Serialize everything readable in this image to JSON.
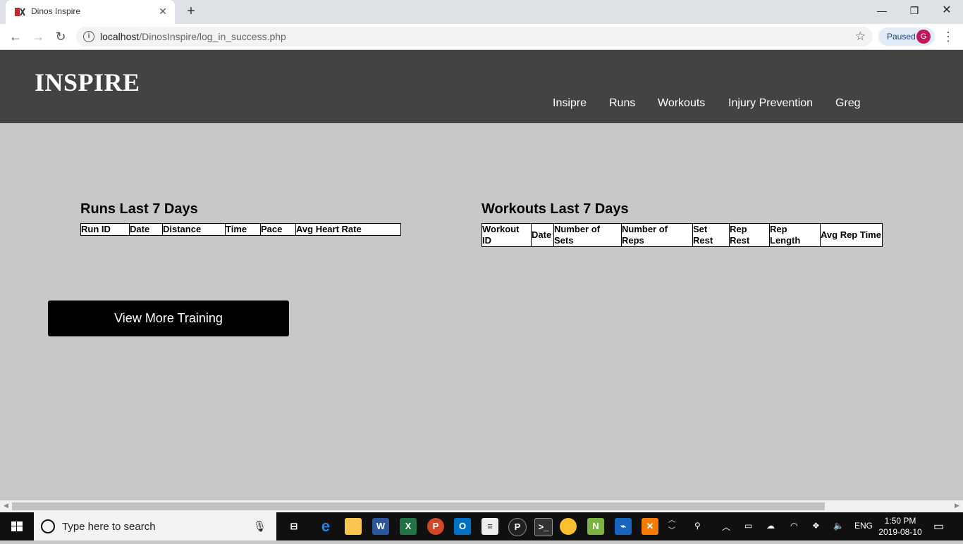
{
  "browser": {
    "tab_title": "Dinos Inspire",
    "url_host": "localhost",
    "url_path": "/DinosInspire/log_in_success.php",
    "profile_status": "Paused",
    "profile_initial": "G"
  },
  "site": {
    "logo": "INSPIRE",
    "nav": [
      "Insipre",
      "Runs",
      "Workouts",
      "Injury Prevention",
      "Greg"
    ]
  },
  "runs": {
    "title": "Runs Last 7 Days",
    "columns": [
      "Run ID",
      "Date",
      "Distance",
      "Time",
      "Pace",
      "Avg Heart Rate"
    ]
  },
  "workouts": {
    "title": "Workouts Last 7 Days",
    "columns": [
      "Workout ID",
      "Date",
      "Number of Sets",
      "Number of Reps",
      "Set Rest",
      "Rep Rest",
      "Rep Length",
      "Avg Rep Time"
    ]
  },
  "actions": {
    "view_more": "View More Training"
  },
  "taskbar": {
    "search_placeholder": "Type here to search",
    "language": "ENG",
    "time": "1:50 PM",
    "date": "2019-08-10"
  },
  "colors": {
    "header_bg": "#434343",
    "page_bg": "#c8c8c8",
    "button_bg": "#000000"
  }
}
